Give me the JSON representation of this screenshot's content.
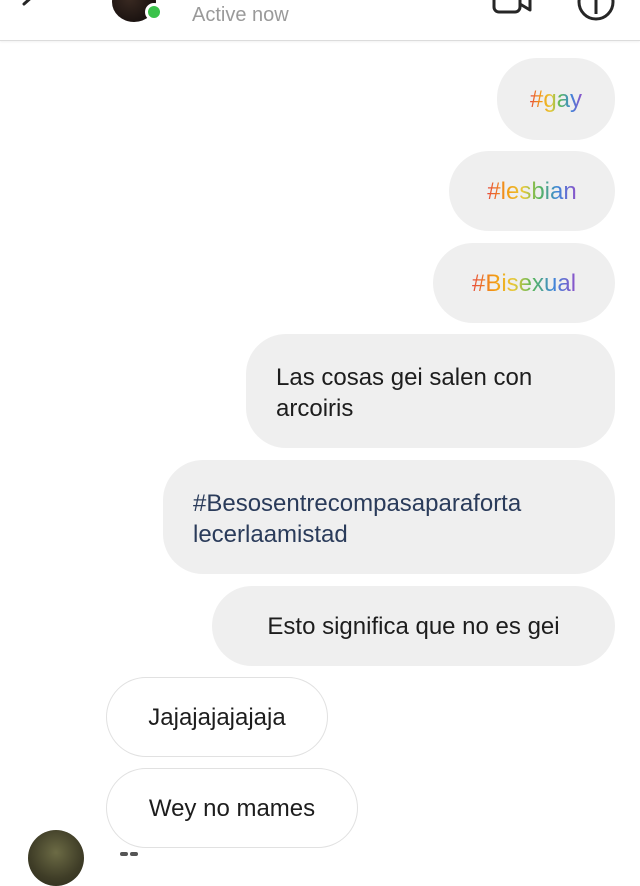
{
  "header": {
    "status": "Active now",
    "icons": {
      "back": "back-arrow-icon",
      "video": "video-call-icon",
      "info": "info-icon"
    },
    "online_color": "#3ac24a"
  },
  "messages": [
    {
      "side": "sent",
      "text": "#gay",
      "style": "rainbow"
    },
    {
      "side": "sent",
      "text": "#lesbian",
      "style": "rainbow"
    },
    {
      "side": "sent",
      "text": "#Bisexual",
      "style": "rainbow"
    },
    {
      "side": "sent",
      "lines": [
        "Las cosas gei salen con",
        "arcoiris"
      ]
    },
    {
      "side": "sent",
      "lines": [
        "#Besosentrecompasaparaforta",
        "lecerlaamistad"
      ],
      "style": "hashtag"
    },
    {
      "side": "sent",
      "text": "Esto significa que no es gei"
    },
    {
      "side": "received",
      "text": "Jajajajajajaja"
    },
    {
      "side": "received",
      "text": "Wey no mames"
    }
  ],
  "colors": {
    "sent_bubble": "#efefef",
    "received_border": "#e1e1e1",
    "hashtag": "#2a3b5a"
  }
}
